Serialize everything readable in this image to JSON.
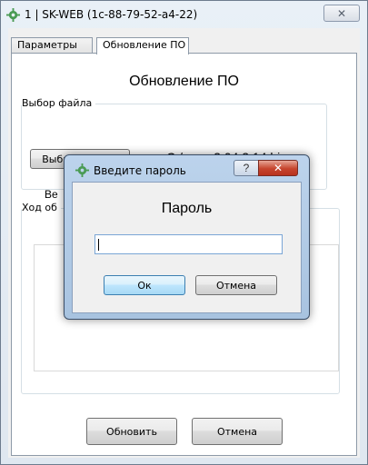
{
  "window": {
    "title": "1  |  SK-WEB (1c-88-79-52-a4-22)",
    "close_glyph": "✕"
  },
  "tabs": [
    {
      "label": "Параметры"
    },
    {
      "label": "Обновление ПО"
    }
  ],
  "panel": {
    "title": "Обновление ПО",
    "file_group_legend": "Выбор файла",
    "choose_file_button": "Выбрать файл",
    "file_name": "C:/www 2.04.2.14.bin",
    "version_label_partial": "Ве",
    "progress_group_legend": "Ход об",
    "update_button": "Обновить",
    "cancel_button": "Отмена"
  },
  "dialog": {
    "title": "Введите пароль",
    "help_glyph": "?",
    "close_glyph": "✕",
    "heading": "Пароль",
    "password_value": "",
    "ok_button": "Ок",
    "cancel_button": "Отмена"
  },
  "colors": {
    "gear_icon": "#4a9b54",
    "dialog_frame": "#a8c3e0",
    "close_red": "#c6442d"
  }
}
